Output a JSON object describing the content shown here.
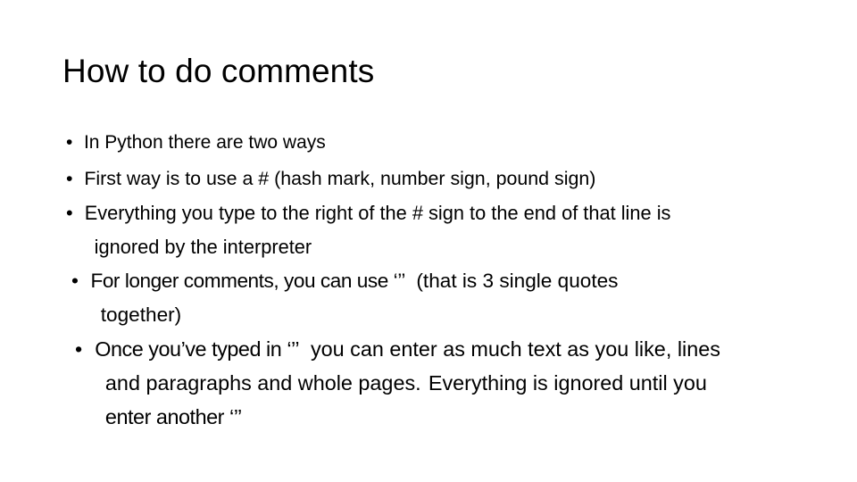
{
  "slide": {
    "title": "How to do comments",
    "background_color": "#ffffff",
    "text_color": "#000000",
    "bullet_glyph": "•",
    "bullets": [
      {
        "id": "bullet-in-python",
        "lines": [
          "In Python there are two ways"
        ]
      },
      {
        "id": "bullet-first-way",
        "lines": [
          "First way is to use a # (hash mark, number sign, pound sign)"
        ]
      },
      {
        "id": "bullet-everything-right-of-hash",
        "lines": [
          "Everything you type to the right of the # sign to the end of that line is",
          "ignored by the interpreter"
        ]
      },
      {
        "id": "bullet-longer-comments",
        "lines": [
          "For longer comments, you can use ‘’’",
          "(that is 3 single quotes",
          "together)"
        ]
      },
      {
        "id": "bullet-once-youve-typed",
        "lines": [
          "Once you’ve typed in ‘’’",
          "you can enter as much text as you like, lines",
          "and paragraphs and whole pages.",
          "Everything is ignored until you",
          "enter another ‘’’"
        ]
      }
    ]
  }
}
